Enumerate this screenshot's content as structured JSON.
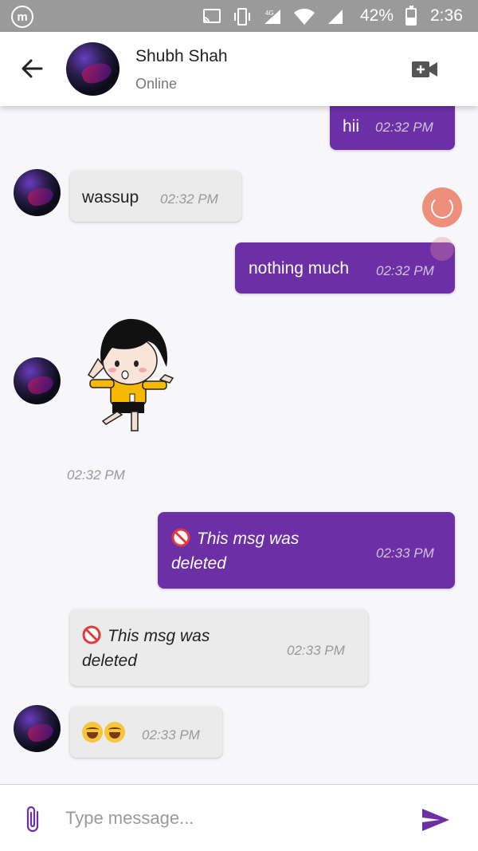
{
  "status_bar": {
    "battery": "42%",
    "time": "2:36",
    "network_label": "4G",
    "icons": [
      "m-logo-icon",
      "cast-icon",
      "vibrate-icon",
      "signal-4g-icon",
      "wifi-icon",
      "signal-icon",
      "battery-icon"
    ]
  },
  "header": {
    "contact_name": "Shubh Shah",
    "contact_status": "Online",
    "icons": [
      "back-arrow-icon",
      "video-call-icon"
    ]
  },
  "messages": [
    {
      "direction": "out",
      "text": "hii",
      "time": "02:32 PM"
    },
    {
      "direction": "in",
      "text": "wassup",
      "time": "02:32 PM"
    },
    {
      "direction": "out",
      "text": "nothing much",
      "time": "02:32 PM"
    },
    {
      "direction": "in",
      "type": "sticker",
      "time": "02:32 PM"
    },
    {
      "direction": "out",
      "type": "deleted",
      "text": "This msg was deleted",
      "time": "02:33 PM"
    },
    {
      "direction": "in",
      "type": "deleted",
      "text": "This msg was deleted",
      "time": "02:33 PM"
    },
    {
      "direction": "in",
      "type": "emoji",
      "emoji_icons": [
        "joy-emoji-icon",
        "joy-emoji-icon"
      ],
      "time": "02:33 PM"
    }
  ],
  "input": {
    "placeholder": "Type message...",
    "value": "",
    "icons": [
      "attach-icon",
      "send-icon"
    ]
  },
  "colors": {
    "accent": "#6c2fa5",
    "incoming_bubble": "#ebebec",
    "status_bar": "#9a9a9a",
    "loader": "#ee8f7b"
  }
}
